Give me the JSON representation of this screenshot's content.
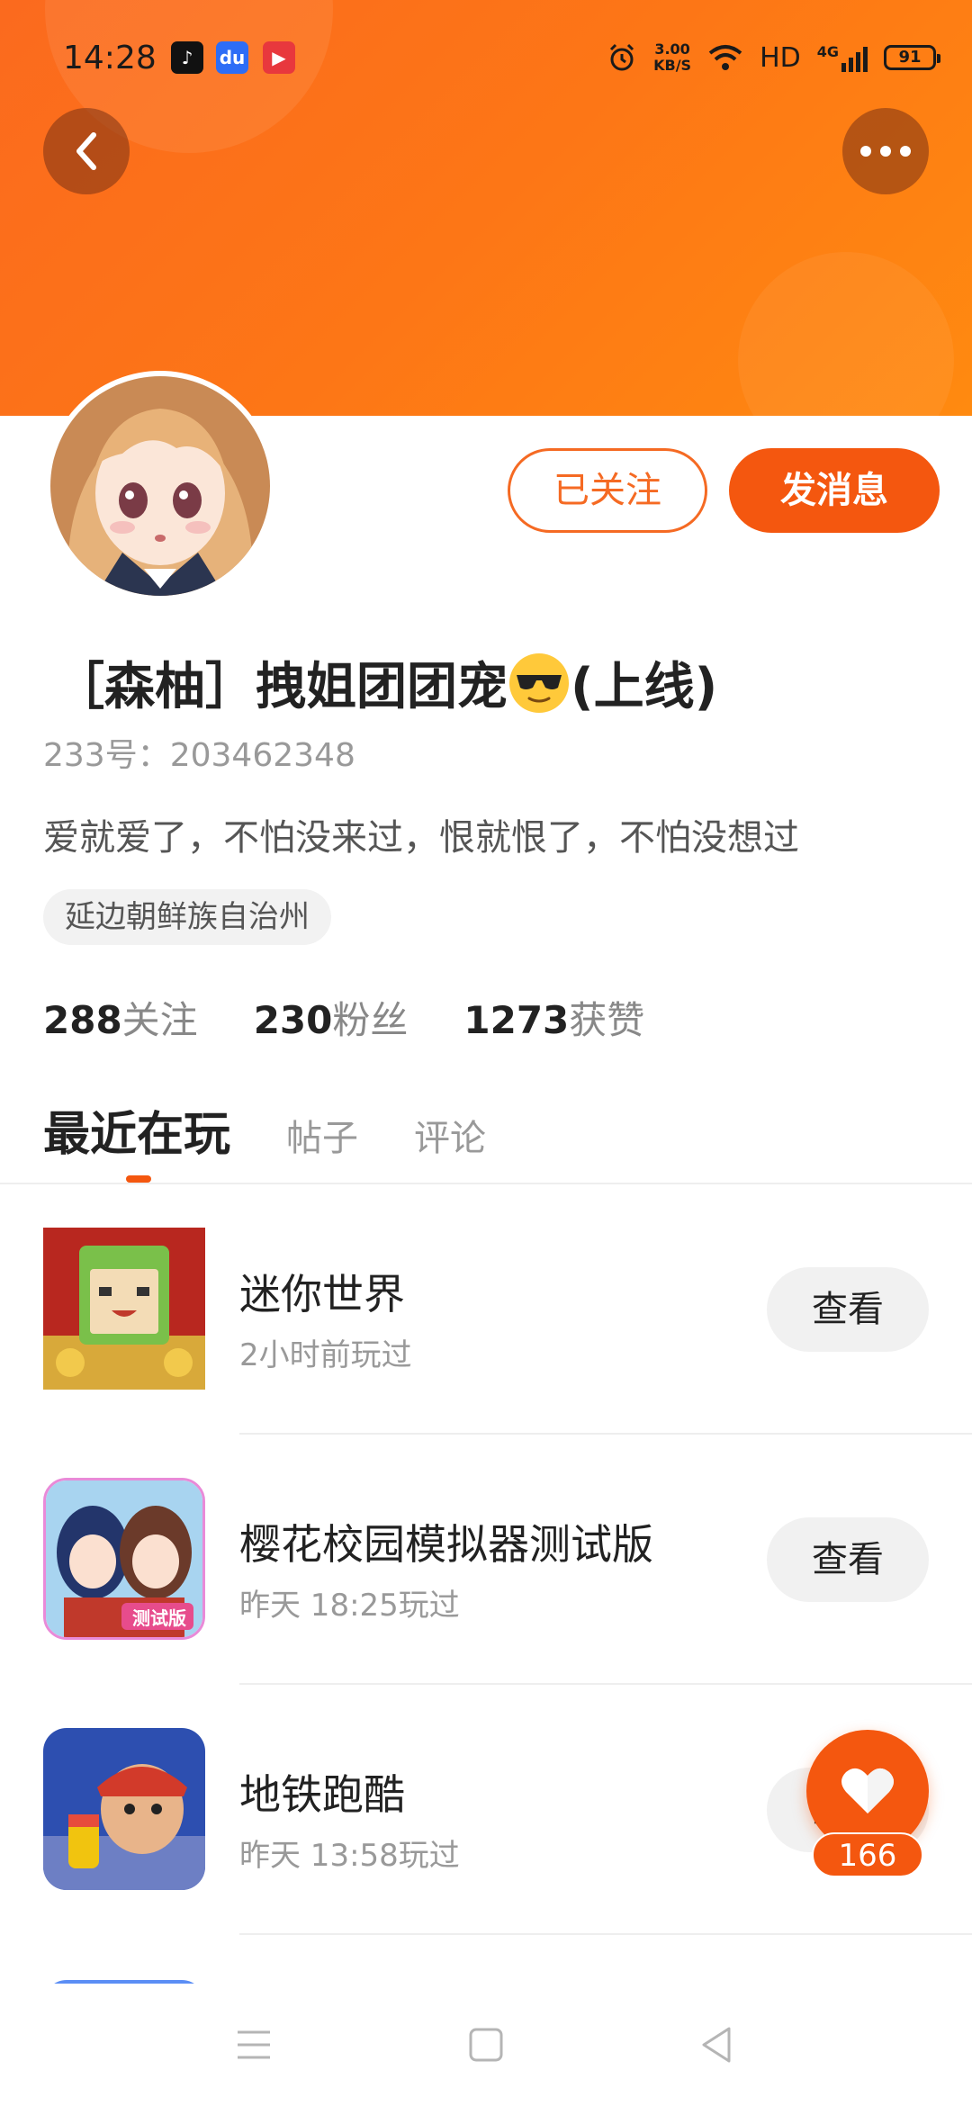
{
  "status_bar": {
    "time": "14:28",
    "network_speed_value": "3.00",
    "network_speed_unit": "KB/S",
    "hd_label": "HD",
    "signal_label": "4G",
    "battery": "91"
  },
  "header": {
    "back_icon": "chevron-left-icon",
    "more_icon": "more-horizontal-icon"
  },
  "profile": {
    "nickname_prefix": "［森柚］拽姐团团宠",
    "nickname_suffix": "(上线)",
    "uid": "233号：203462348",
    "bio": "爱就爱了，不怕没来过，恨就恨了，不怕没想过",
    "location": "延边朝鲜族自治州",
    "follow_button": "已关注",
    "message_button": "发消息"
  },
  "stats": [
    {
      "value": "288",
      "label": "关注"
    },
    {
      "value": "230",
      "label": "粉丝"
    },
    {
      "value": "1273",
      "label": "获赞"
    }
  ],
  "tabs": [
    {
      "label": "最近在玩",
      "active": true
    },
    {
      "label": "帖子",
      "active": false
    },
    {
      "label": "评论",
      "active": false
    }
  ],
  "games": [
    {
      "name": "迷你世界",
      "time": "2小时前玩过",
      "action": "查看"
    },
    {
      "name": "樱花校园模拟器测试版",
      "time": "昨天 18:25玩过",
      "action": "查看"
    },
    {
      "name": "地铁跑酷",
      "time": "昨天 13:58玩过",
      "action": "查看"
    }
  ],
  "game_badges": {
    "sakura_badge": "测试版"
  },
  "fab": {
    "icon": "heart-icon",
    "count": "166"
  },
  "colors": {
    "accent": "#f4570f",
    "banner_start": "#fb6a1e",
    "banner_end": "#ff8a10"
  }
}
